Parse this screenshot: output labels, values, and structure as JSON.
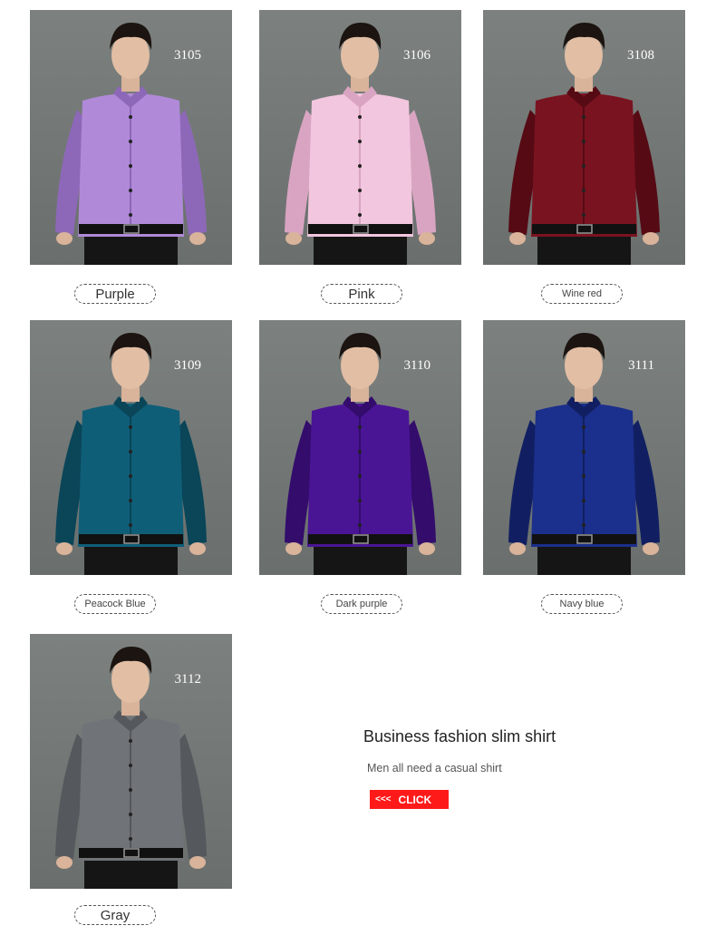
{
  "products": [
    {
      "code": "3105",
      "label": "Purple",
      "shirt": "#b08ad8",
      "shade": "#8d68b8"
    },
    {
      "code": "3106",
      "label": "Pink",
      "shirt": "#f2c6de",
      "shade": "#d9a4c2"
    },
    {
      "code": "3108",
      "label": "Wine red",
      "shirt": "#7a1320",
      "shade": "#560a14"
    },
    {
      "code": "3109",
      "label": "Peacock Blue",
      "shirt": "#0f5e78",
      "shade": "#0a4558"
    },
    {
      "code": "3110",
      "label": "Dark purple",
      "shirt": "#4a1595",
      "shade": "#330c6c"
    },
    {
      "code": "3111",
      "label": "Navy blue",
      "shirt": "#1b2f8c",
      "shade": "#111f62"
    },
    {
      "code": "3112",
      "label": "Gray",
      "shirt": "#707378",
      "shade": "#55585c"
    }
  ],
  "promo": {
    "title": "Business fashion slim shirt",
    "subtitle": "Men all need a casual shirt",
    "button_arrows": "<<<",
    "button_label": "CLICK"
  }
}
